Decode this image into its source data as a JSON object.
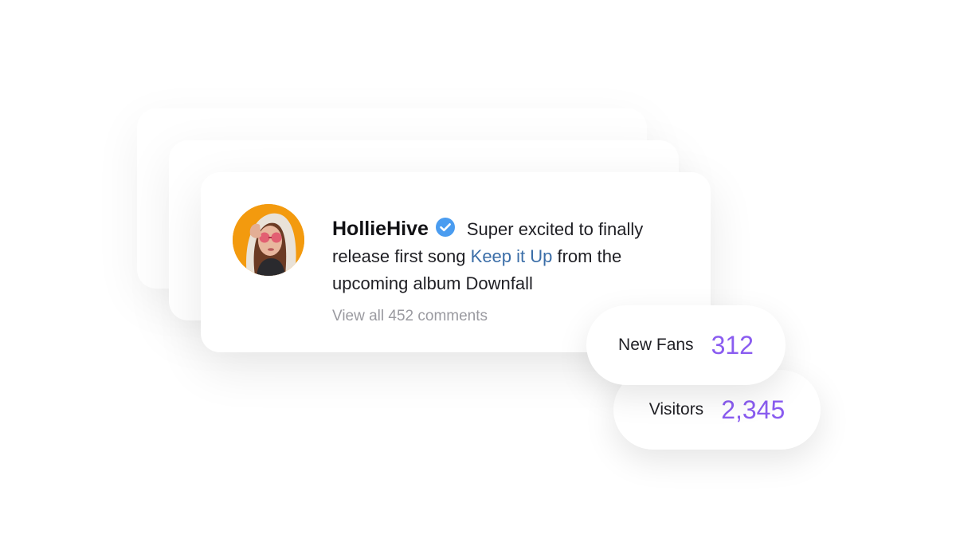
{
  "post": {
    "username": "HollieHive",
    "verified_icon": "verified-badge-icon",
    "text_before_link": "Super excited to finally release first song ",
    "song_link": "Keep it Up",
    "text_after_link": " from the upcoming album Downfall",
    "comments_link": "View all 452 comments"
  },
  "stats": {
    "new_fans": {
      "label": "New Fans",
      "value": "312"
    },
    "visitors": {
      "label": "Visitors",
      "value": "2,345"
    }
  },
  "colors": {
    "accent_purple": "#8a5cf0",
    "link_blue": "#3b6ea8",
    "verified_blue": "#4a9cf0",
    "avatar_bg": "#f39a0e"
  }
}
